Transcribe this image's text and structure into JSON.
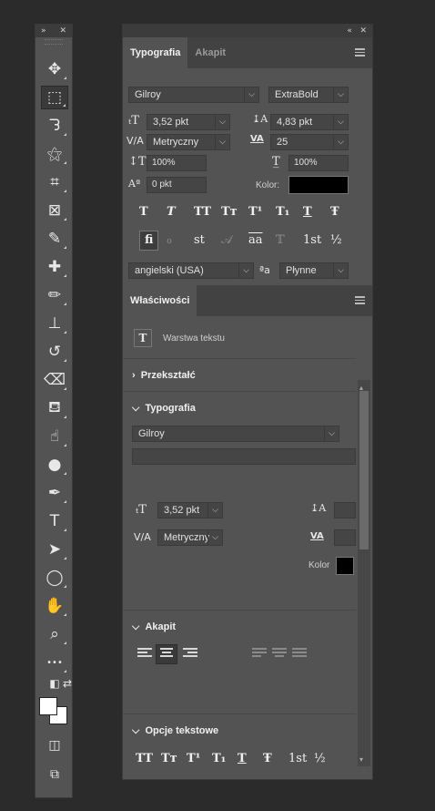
{
  "toolbar": {
    "header": {
      "expand": "»",
      "close": "✕"
    },
    "tools": [
      {
        "name": "move-tool-icon",
        "glyph": "✥",
        "active": false
      },
      {
        "name": "rectangular-marquee-tool-icon",
        "glyph": "⬚",
        "active": true
      },
      {
        "name": "lasso-tool-icon",
        "glyph": "ᘊ",
        "active": false
      },
      {
        "name": "magic-wand-tool-icon",
        "glyph": "⚝",
        "active": false
      },
      {
        "name": "crop-tool-icon",
        "glyph": "⌗",
        "active": false
      },
      {
        "name": "frame-tool-icon",
        "glyph": "⊠",
        "active": false
      },
      {
        "name": "eyedropper-tool-icon",
        "glyph": "✎",
        "active": false
      },
      {
        "name": "healing-brush-tool-icon",
        "glyph": "✚",
        "active": false
      },
      {
        "name": "brush-tool-icon",
        "glyph": "✏",
        "active": false
      },
      {
        "name": "clone-stamp-tool-icon",
        "glyph": "⊥",
        "active": false
      },
      {
        "name": "history-brush-tool-icon",
        "glyph": "↺",
        "active": false
      },
      {
        "name": "eraser-tool-icon",
        "glyph": "⌫",
        "active": false
      },
      {
        "name": "paint-bucket-tool-icon",
        "glyph": "⛾",
        "active": false
      },
      {
        "name": "smudge-tool-icon",
        "glyph": "☝",
        "active": false
      },
      {
        "name": "dodge-tool-icon",
        "glyph": "●",
        "active": false
      },
      {
        "name": "pen-tool-icon",
        "glyph": "✒",
        "active": false
      },
      {
        "name": "type-tool-icon",
        "glyph": "T",
        "active": false
      },
      {
        "name": "path-selection-tool-icon",
        "glyph": "➤",
        "active": false
      },
      {
        "name": "ellipse-tool-icon",
        "glyph": "◯",
        "active": false
      },
      {
        "name": "hand-tool-icon",
        "glyph": "✋",
        "active": false
      },
      {
        "name": "zoom-tool-icon",
        "glyph": "⌕",
        "active": false
      },
      {
        "name": "edit-toolbar-icon",
        "glyph": "•••",
        "active": false
      }
    ],
    "bottom": {
      "default_colors": "◧",
      "swap_colors": "⇄",
      "quick_mask": "◫",
      "screen_mode": "⧉"
    },
    "foreground_color": "#ffffff",
    "background_color": "#ffffff"
  },
  "panel_header": {
    "collapse": "«",
    "close": "✕"
  },
  "character": {
    "tabs": [
      "Typografia",
      "Akapit"
    ],
    "font_family": "Gilroy",
    "font_style": "ExtraBold",
    "font_size": "3,52 pkt",
    "leading": "4,83 pkt",
    "kerning": "Metryczny",
    "tracking": "25",
    "vertical_scale": "100%",
    "horizontal_scale": "100%",
    "baseline_shift": "0 pkt",
    "color_label": "Kolor:",
    "color": "#000000",
    "style_buttons": [
      "T",
      "T",
      "TT",
      "Tт",
      "T¹",
      "T₁",
      "T",
      "Ŧ"
    ],
    "opentype_buttons": [
      "ﬁ",
      "ℴ",
      "st",
      "𝒜",
      "aa",
      "𝕋",
      "1st",
      "½"
    ],
    "language": "angielski (USA)",
    "aa_icon": "ªa",
    "anti_alias": "Płynne"
  },
  "properties": {
    "tab": "Właściwości",
    "layer_type": "Warstwa tekstu",
    "sections": {
      "transform": "Przekształć",
      "typography": "Typografia",
      "paragraph": "Akapit",
      "text_options": "Opcje tekstowe"
    },
    "font_family": "Gilroy",
    "font_style": "",
    "font_size": "3,52 pkt",
    "kerning": "Metryczny",
    "color_label": "Kolor",
    "color": "#000000",
    "text_option_buttons": [
      "TT",
      "Tт",
      "T¹",
      "T₁",
      "T",
      "Ŧ",
      "1st",
      "½"
    ]
  }
}
